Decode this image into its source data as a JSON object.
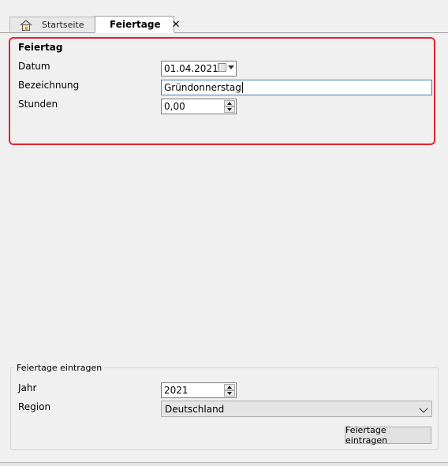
{
  "tabs": {
    "start": {
      "label": "Startseite",
      "icon": "home-icon"
    },
    "active": {
      "label": "Feiertage",
      "close": "✕"
    }
  },
  "holiday": {
    "section_title": "Feiertag",
    "date_label": "Datum",
    "date_value": "01.04.2021",
    "name_label": "Bezeichnung",
    "name_value": "Gründonnerstag",
    "hours_label": "Stunden",
    "hours_value": "0,00"
  },
  "import": {
    "group_title": "Feiertage eintragen",
    "year_label": "Jahr",
    "year_value": "2021",
    "region_label": "Region",
    "region_value": "Deutschland",
    "button_label": "Feiertage eintragen"
  },
  "colors": {
    "highlight": "#e5232f",
    "focus_border": "#3c7fb1"
  }
}
